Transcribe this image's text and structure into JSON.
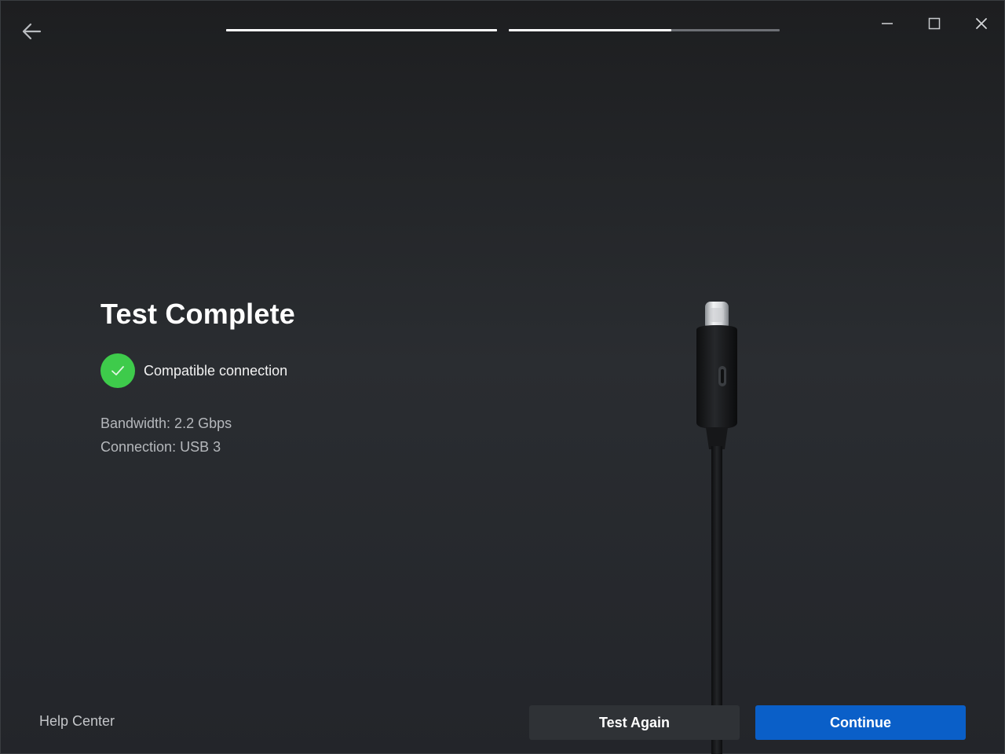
{
  "window": {
    "back_icon": "arrow-left-icon",
    "minimize_icon": "minimize-icon",
    "maximize_icon": "maximize-icon",
    "close_icon": "close-icon"
  },
  "progress": {
    "steps": [
      {
        "fill": 1.0
      },
      {
        "fill": 0.6
      }
    ]
  },
  "main": {
    "title": "Test Complete",
    "status": {
      "icon": "check-icon",
      "text": "Compatible connection",
      "color": "#3ecb4b"
    },
    "details": [
      "Bandwidth: 2.2 Gbps",
      "Connection: USB 3"
    ]
  },
  "footer": {
    "help_label": "Help Center",
    "test_again_label": "Test Again",
    "continue_label": "Continue",
    "primary_color": "#0a5fc8"
  },
  "illustration": {
    "icon": "usb-c-cable-icon"
  }
}
